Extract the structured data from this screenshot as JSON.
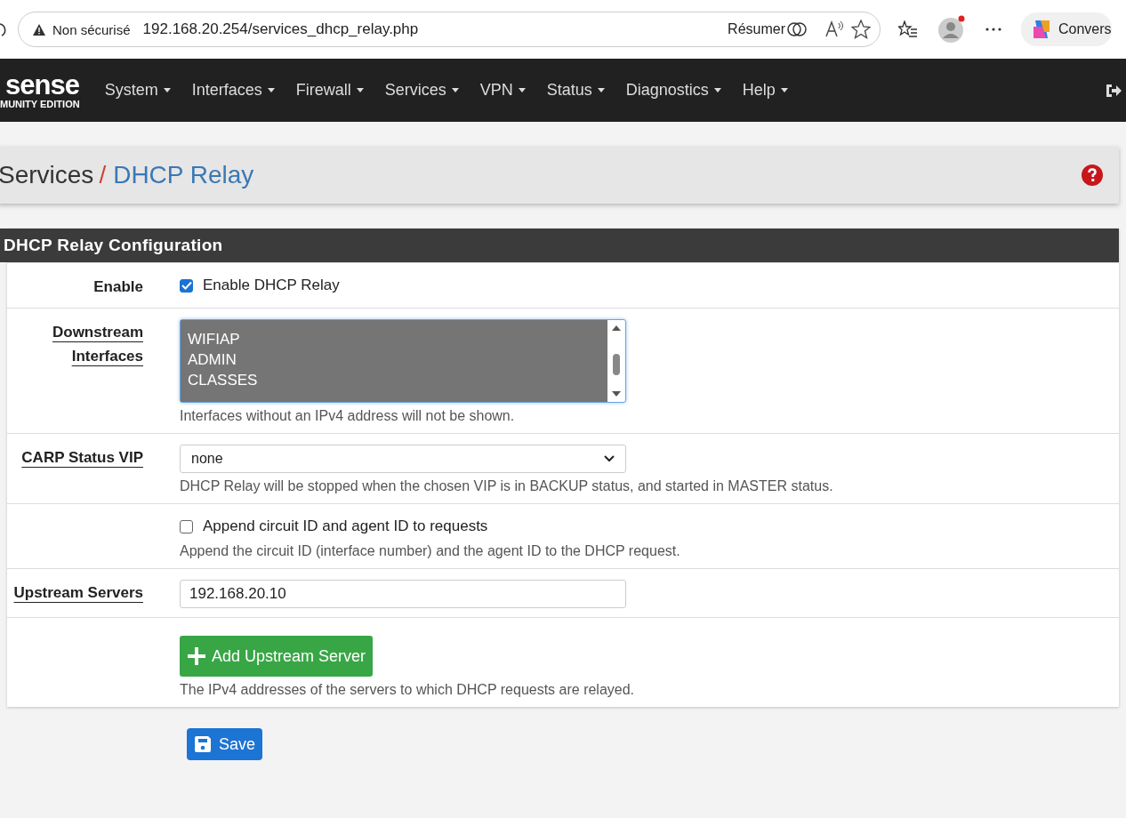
{
  "browser": {
    "security": "Non sécurisé",
    "url": "192.168.20.254/services_dhcp_relay.php",
    "summarize": "Résumer",
    "copilot_label": "Convers"
  },
  "navbar": {
    "logo": "sense",
    "logo_sub": "MUNITY EDITION",
    "menus": [
      "System",
      "Interfaces",
      "Firewall",
      "Services",
      "VPN",
      "Status",
      "Diagnostics",
      "Help"
    ]
  },
  "breadcrumb": {
    "parent": "Services",
    "separator": "/",
    "current": "DHCP Relay"
  },
  "panel": {
    "title": "DHCP Relay Configuration",
    "rows": [
      {
        "kind": "checkbox",
        "label": "Enable",
        "linked": false,
        "checked": true,
        "text": "Enable DHCP Relay"
      },
      {
        "kind": "listbox",
        "label": "Downstream Interfaces",
        "linked": true,
        "options": [
          {
            "text": "WIFIAP",
            "selected": true
          },
          {
            "text": "ADMIN",
            "selected": true
          },
          {
            "text": "CLASSES",
            "selected": true
          }
        ],
        "help": "Interfaces without an IPv4 address will not be shown."
      },
      {
        "kind": "select",
        "label": "CARP Status VIP",
        "linked": true,
        "value": "none",
        "help": "DHCP Relay will be stopped when the chosen VIP is in BACKUP status, and started in MASTER status."
      },
      {
        "kind": "checkbox",
        "checked": false,
        "text": "Append circuit ID and agent ID to requests",
        "help": "Append the circuit ID (interface number) and the agent ID to the DHCP request."
      },
      {
        "kind": "input",
        "label": "Upstream Servers",
        "linked": true,
        "value": "192.168.20.10"
      },
      {
        "kind": "button",
        "text": "Add Upstream Server",
        "help": "The IPv4 addresses of the servers to which DHCP requests are relayed."
      }
    ]
  },
  "save": "Save"
}
